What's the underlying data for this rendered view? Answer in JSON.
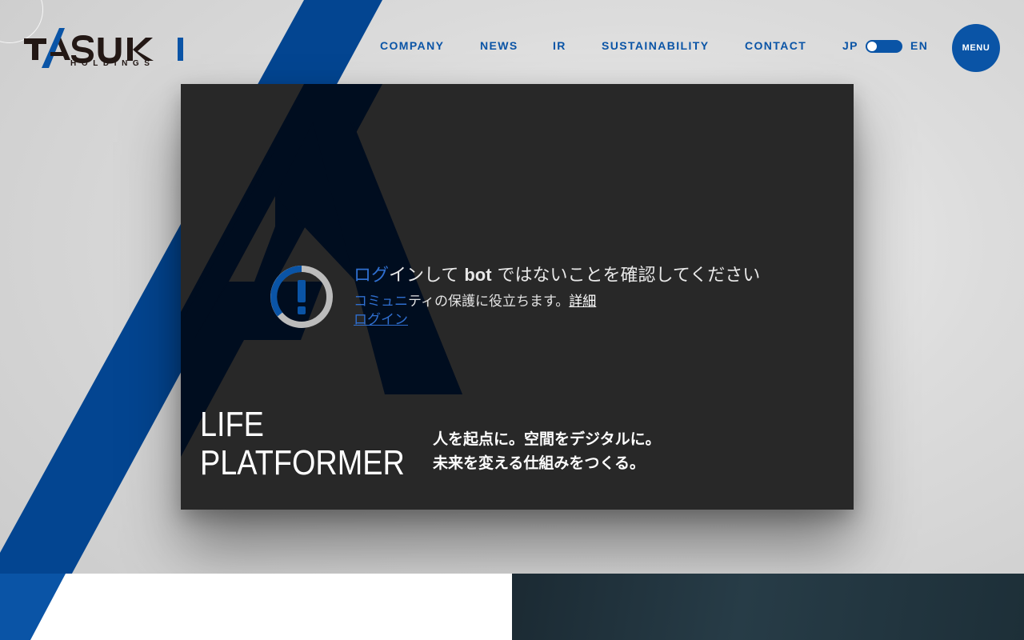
{
  "brand": {
    "logo_text": "TASUKI",
    "logo_sub": "HOLDINGS",
    "primary_color": "#0a54a6",
    "dark_color": "#231815"
  },
  "nav": {
    "items": [
      {
        "label": "COMPANY"
      },
      {
        "label": "NEWS"
      },
      {
        "label": "IR"
      },
      {
        "label": "SUSTAINABILITY"
      },
      {
        "label": "CONTACT"
      }
    ],
    "lang_jp": "JP",
    "lang_en": "EN",
    "lang_selected": "JP",
    "menu_label": "MENU"
  },
  "notice": {
    "icon": "exclamation-circle-icon",
    "title_highlight": "ログ",
    "title_rest_1": "インして ",
    "title_bold": "bot",
    "title_rest_2": " ではないことを確認してください",
    "desc_highlight": "コミュニ",
    "desc_rest": "ティの保護に役立ちます。",
    "detail_link": "詳細",
    "login_link": "ログイン",
    "link_color": "#2f6fd0"
  },
  "hero": {
    "tagline_line1": "LIFE",
    "tagline_line2": "PLATFORMER",
    "catch_line1": "人を起点に。空間をデジタルに。",
    "catch_line2": "未来を変える仕組みをつくる。",
    "card_color": "#282828"
  }
}
